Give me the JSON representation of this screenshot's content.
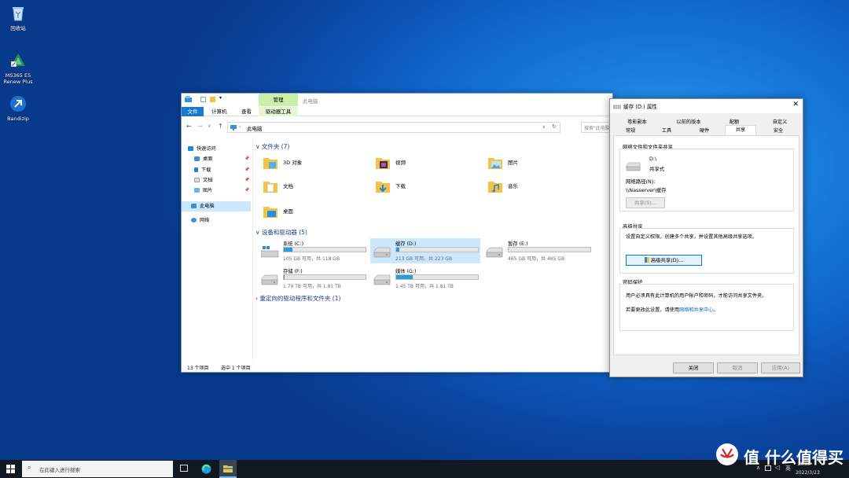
{
  "desktop": {
    "icons": [
      {
        "label": "回收站"
      },
      {
        "label": "MS365 E5 Renew Plus"
      },
      {
        "label": "Bandizip"
      }
    ]
  },
  "explorer": {
    "title": "此电脑",
    "qat_manage": "管理",
    "tabs": [
      "文件",
      "计算机",
      "查看",
      "驱动器工具"
    ],
    "address": "此电脑",
    "search_placeholder": "搜索\"此电脑\"",
    "nav": {
      "quick_access": "快速访问",
      "items": [
        "桌面",
        "下载",
        "文档",
        "图片"
      ],
      "this_pc": "此电脑",
      "network": "网络"
    },
    "folders_header": "文件夹 (7)",
    "folders": [
      "3D 对象",
      "视频",
      "图片",
      "文档",
      "下载",
      "音乐",
      "桌面"
    ],
    "drives_header": "设备和驱动器 (5)",
    "drives": [
      {
        "name": "系统 (C:)",
        "free": "105 GB 可用，共 118 GB",
        "used_fraction": 0.11
      },
      {
        "name": "缓存 (D:)",
        "free": "213 GB 可用，共 223 GB",
        "used_fraction": 0.04
      },
      {
        "name": "暂存 (E:)",
        "free": "465 GB 可用，共 465 GB",
        "used_fraction": 0.0
      },
      {
        "name": "存储 (F:)",
        "free": "1.79 TB 可用，共 1.81 TB",
        "used_fraction": 0.01
      },
      {
        "name": "媒体 (G:)",
        "free": "1.45 TB 可用，共 1.81 TB",
        "used_fraction": 0.2
      }
    ],
    "redirect_header": "重定向的驱动程序和文件夹 (1)",
    "status_count": "13 个项目",
    "status_selected": "选中 1 个项目"
  },
  "properties": {
    "title": "缓存 (D:) 属性",
    "tabs_row1": [
      "卷影副本",
      "以前的版本",
      "配额",
      "自定义"
    ],
    "tabs_row2": [
      "常规",
      "工具",
      "硬件",
      "共享",
      "安全"
    ],
    "active_tab": "共享",
    "net_share_title": "网络文件和文件夹共享",
    "share_name": "D:\\",
    "share_state": "共享式",
    "net_path_label": "网络路径(N):",
    "net_path": "\\\\Nasserver\\缓存",
    "share_button": "共享(S)...",
    "adv_title": "高级共享",
    "adv_desc": "设置自定义权限，创建多个共享，并设置其他高级共享选项。",
    "adv_button": "高级共享(D)...",
    "pwd_title": "密码保护",
    "pwd_desc": "用户必须具有此计算机的用户帐户和密码，才能访问共享文件夹。",
    "pwd_change_prefix": "若要更改此设置，请使用",
    "pwd_link": "网络和共享中心",
    "pwd_suffix": "。",
    "ok": "关闭",
    "cancel": "取消",
    "apply": "应用(A)"
  },
  "taskbar": {
    "search_placeholder": "在此键入进行搜索",
    "tray_ime": "英",
    "time": "15:xx",
    "date": "2022/3/23"
  },
  "watermark": "值 什么值得买",
  "colors": {
    "accent": "#0078d7",
    "bar": "#26a0da",
    "folder": "#f5c342"
  }
}
